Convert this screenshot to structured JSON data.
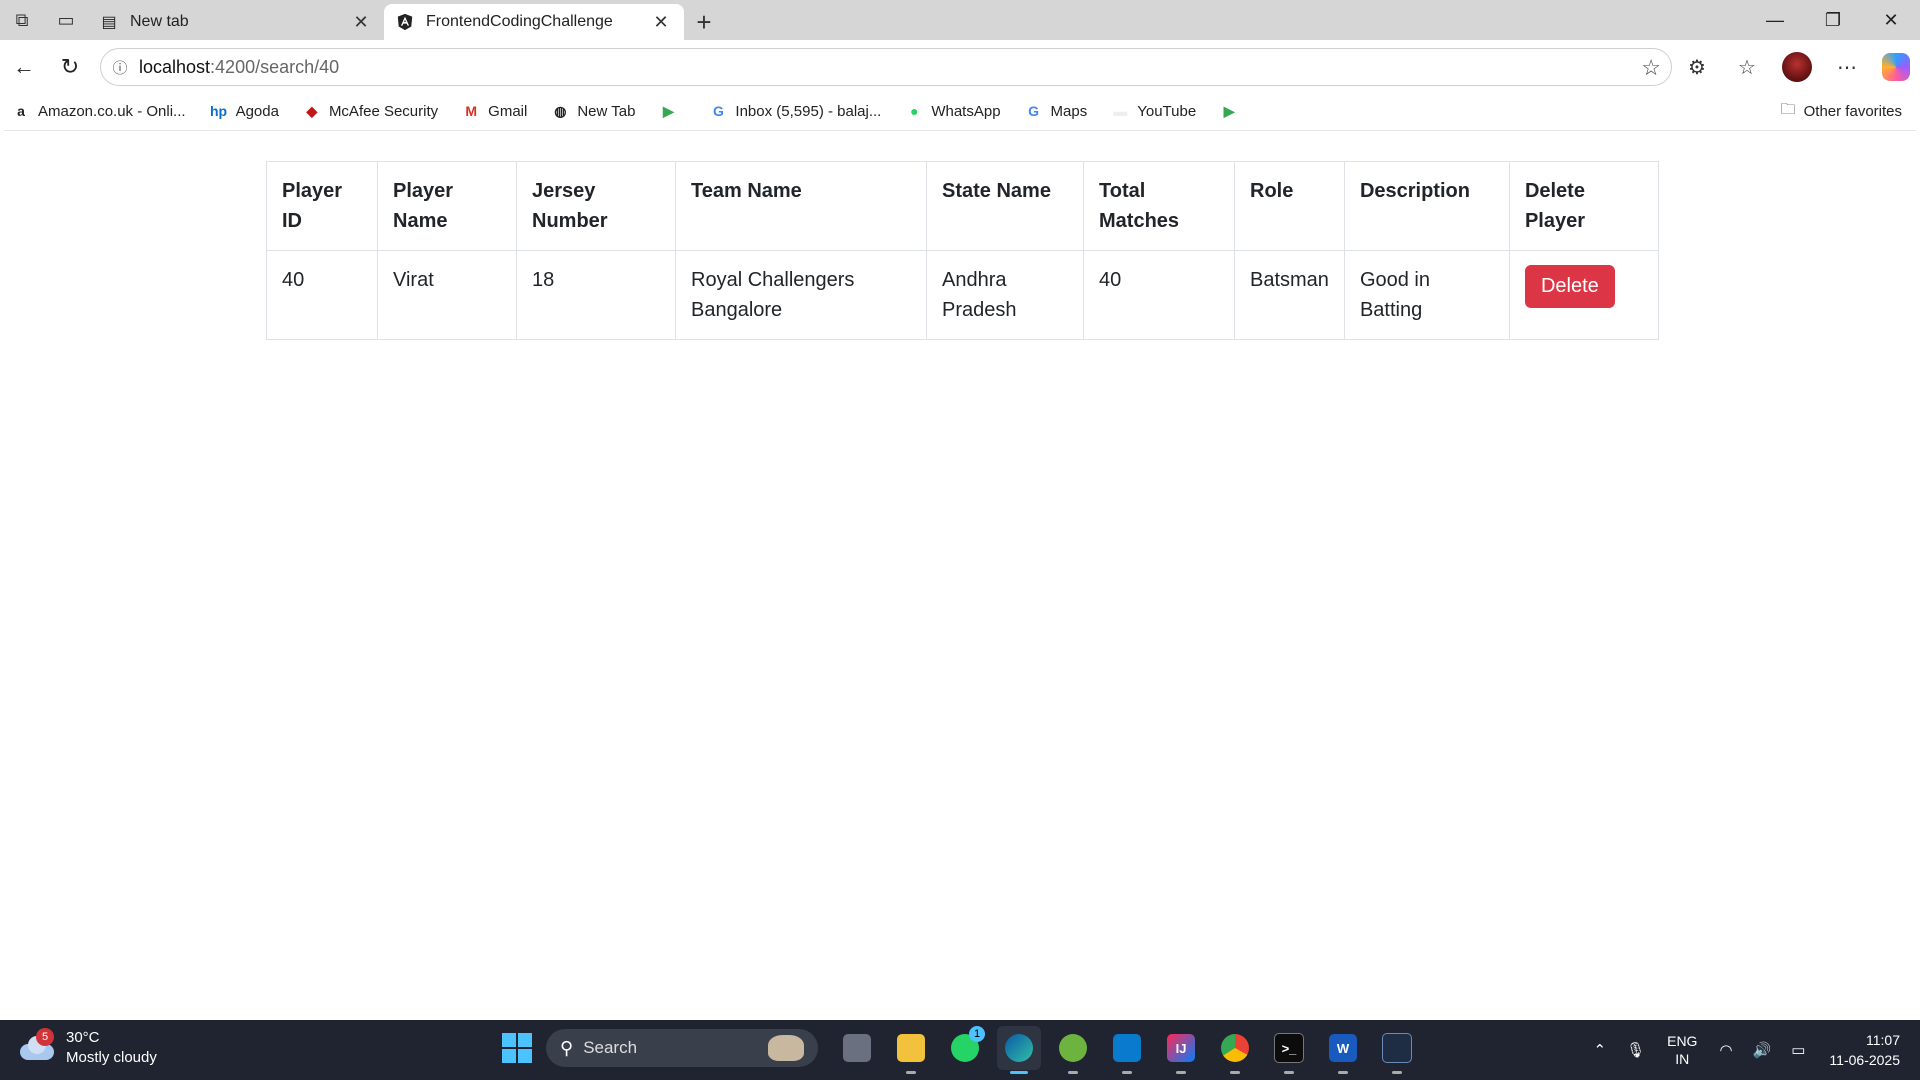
{
  "tabs": [
    {
      "label": "New tab",
      "active": false
    },
    {
      "label": "FrontendCodingChallenge",
      "active": true
    }
  ],
  "address": {
    "host": "localhost",
    "path": ":4200/search/40"
  },
  "bookmarks": [
    {
      "label": "Amazon.co.uk - Onli...",
      "icon": "amazon-icon"
    },
    {
      "label": "Agoda",
      "icon": "hp-icon"
    },
    {
      "label": "McAfee Security",
      "icon": "mcafee-icon"
    },
    {
      "label": "Gmail",
      "icon": "gmail-icon"
    },
    {
      "label": "New Tab",
      "icon": "globe-icon"
    },
    {
      "label": "",
      "icon": "play-store-icon"
    },
    {
      "label": "Inbox (5,595) - balaj...",
      "icon": "google-icon"
    },
    {
      "label": "WhatsApp",
      "icon": "whatsapp-icon"
    },
    {
      "label": "Maps",
      "icon": "google-icon"
    },
    {
      "label": "YouTube",
      "icon": "youtube-icon"
    },
    {
      "label": "",
      "icon": "play-store-icon"
    }
  ],
  "other_favorites": "Other favorites",
  "table": {
    "headers": [
      [
        "Player",
        "ID"
      ],
      [
        "Player",
        "Name"
      ],
      [
        "Jersey",
        "Number"
      ],
      [
        "Team Name"
      ],
      [
        "State Name"
      ],
      [
        "Total",
        "Matches"
      ],
      [
        "Role"
      ],
      [
        "Description"
      ],
      [
        "Delete",
        "Player"
      ]
    ],
    "rows": [
      {
        "cells": [
          [
            "40"
          ],
          [
            "Virat"
          ],
          [
            "18"
          ],
          [
            "Royal Challengers",
            "Bangalore"
          ],
          [
            "Andhra",
            "Pradesh"
          ],
          [
            "40"
          ],
          [
            "Batsman"
          ],
          [
            "Good in",
            "Batting"
          ]
        ],
        "action": "Delete"
      }
    ]
  },
  "taskbar": {
    "weather_badge": "5",
    "temperature": "30°C",
    "condition": "Mostly cloudy",
    "search_placeholder": "Search",
    "whatsapp_badge": "1",
    "lang_top": "ENG",
    "lang_bottom": "IN",
    "time": "11:07",
    "date": "11-06-2025"
  },
  "colors": {
    "danger": "#dc3545",
    "taskbar": "#1f2430",
    "accent": "#4cc2ff"
  }
}
